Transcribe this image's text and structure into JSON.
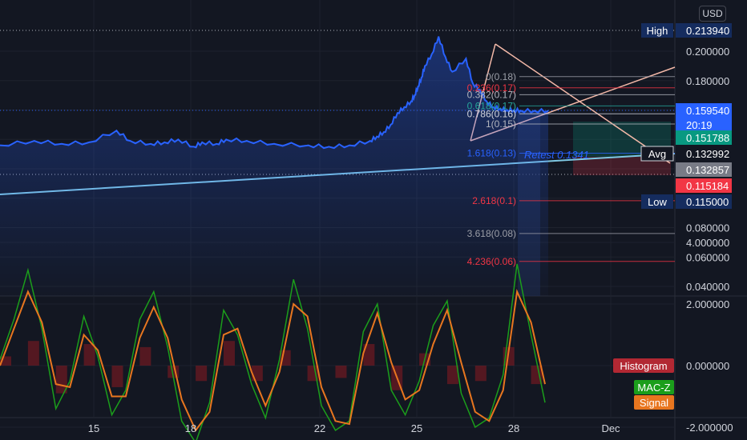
{
  "currency_badge": "USD",
  "chart_data": [
    {
      "type": "line",
      "title": "",
      "x_ticks": [
        "15",
        "18",
        "22",
        "25",
        "28",
        "Dec"
      ],
      "y_ticks": [
        "0.200000",
        "0.180000",
        "0.080000",
        "0.060000",
        "0.040000"
      ],
      "ylim": [
        0.033,
        0.222
      ],
      "series": [
        {
          "x": [
            0,
            5,
            9,
            13,
            17,
            19,
            22,
            24,
            26,
            28.3,
            29.5,
            31.6,
            33,
            36,
            40,
            45,
            48,
            51,
            54,
            55,
            56,
            57,
            58,
            59,
            60,
            60.5,
            61,
            61.5,
            62,
            63,
            64,
            65,
            66,
            68,
            69,
            70,
            71,
            72,
            73,
            74,
            75,
            76,
            78,
            80
          ],
          "values": [
            0.136,
            0.139,
            0.137,
            0.138,
            0.146,
            0.139,
            0.137,
            0.138,
            0.14,
            0.135,
            0.138,
            0.137,
            0.14,
            0.139,
            0.137,
            0.136,
            0.135,
            0.136,
            0.139,
            0.142,
            0.145,
            0.15,
            0.158,
            0.162,
            0.166,
            0.17,
            0.176,
            0.182,
            0.19,
            0.198,
            0.21,
            0.196,
            0.186,
            0.195,
            0.178,
            0.174,
            0.166,
            0.162,
            0.161,
            0.16,
            0.16,
            0.1596,
            0.1595,
            0.1595
          ],
          "color": "#2962ff"
        }
      ],
      "fib_levels": [
        {
          "label": "0(0.18)",
          "value": 0.1827,
          "color": "#9b9ea7"
        },
        {
          "label": "0.236(0.17)",
          "value": 0.1751,
          "color": "#f23645"
        },
        {
          "label": "0.382(0.17)",
          "value": 0.1704,
          "color": "#b2b5be"
        },
        {
          "label": "0.618(0.17)",
          "value": 0.1628,
          "color": "#26a69a"
        },
        {
          "label": "0.786(0.16)",
          "value": 0.1574,
          "color": "#d1d4dc"
        },
        {
          "label": "1(0.15)",
          "value": 0.1505,
          "color": "#b2b5be"
        },
        {
          "label": "1.618(0.13)",
          "value": 0.1306,
          "color": "#2962ff"
        },
        {
          "label": "2.618(0.1)",
          "value": 0.0983,
          "color": "#f23645"
        },
        {
          "label": "3.618(0.08)",
          "value": 0.076,
          "color": "#9b9ea7"
        },
        {
          "label": "4.236(0.06)",
          "value": 0.057,
          "color": "#f23645"
        }
      ],
      "annotations": {
        "retest_text": "Retest 0.1341"
      },
      "price_labels": [
        {
          "tag": "High",
          "value": "0.213940",
          "bg": "#152c5e"
        },
        {
          "tag": "",
          "value": "0.159540",
          "bg": "#2962ff",
          "sub": "20:19"
        },
        {
          "tag": "",
          "value": "0.151788",
          "bg": "#089981"
        },
        {
          "tag": "Avg",
          "value": "0.132992",
          "bg": "#131722"
        },
        {
          "tag": "",
          "value": "0.132857",
          "bg": "#787b86"
        },
        {
          "tag": "",
          "value": "0.115184",
          "bg": "#f23645"
        },
        {
          "tag": "Low",
          "value": "0.115000",
          "bg": "#152c5e"
        }
      ]
    },
    {
      "type": "line",
      "title": "",
      "y_ticks": [
        "4.000000",
        "2.000000",
        "0.000000",
        "-2.000000"
      ],
      "ylim": [
        -2.9,
        4.2
      ],
      "series": [
        {
          "name": "MAC-Z",
          "color": "#1b9e1b",
          "x": [
            0,
            2,
            4,
            6,
            8,
            10,
            12,
            14,
            16,
            18,
            20,
            22,
            24,
            26,
            28,
            30,
            32,
            34,
            36,
            38,
            40,
            42,
            44,
            46,
            48,
            50,
            52,
            54,
            56,
            58,
            60,
            62,
            64,
            66,
            68,
            70,
            72,
            74,
            76,
            78
          ],
          "values": [
            0.2,
            1.5,
            3.1,
            1.2,
            -1.4,
            -0.5,
            1.6,
            0.3,
            -1.6,
            -0.8,
            1.5,
            2.4,
            0.6,
            -1.8,
            -2.5,
            -1.2,
            1.8,
            1.0,
            -0.6,
            -1.7,
            0.2,
            2.8,
            1.2,
            -1.3,
            -2.1,
            -1.8,
            1.1,
            2.0,
            -0.8,
            -1.6,
            -0.5,
            1.3,
            2.1,
            -0.9,
            -2.0,
            -1.7,
            -0.3,
            3.3,
            1.0,
            -1.2
          ]
        },
        {
          "name": "Signal",
          "color": "#e8761f",
          "x": [
            0,
            2,
            4,
            6,
            8,
            10,
            12,
            14,
            16,
            18,
            20,
            22,
            24,
            26,
            28,
            30,
            32,
            34,
            36,
            38,
            40,
            42,
            44,
            46,
            48,
            50,
            52,
            54,
            56,
            58,
            60,
            62,
            64,
            66,
            68,
            70,
            72,
            74,
            76,
            78
          ],
          "values": [
            0.0,
            1.2,
            2.4,
            1.4,
            -0.6,
            -0.7,
            1.0,
            0.5,
            -1.0,
            -1.0,
            0.9,
            1.9,
            0.9,
            -1.1,
            -2.1,
            -1.5,
            1.0,
            1.2,
            -0.2,
            -1.3,
            -0.2,
            2.0,
            1.6,
            -0.7,
            -1.8,
            -1.9,
            0.4,
            1.7,
            0.1,
            -1.1,
            -0.8,
            0.7,
            1.8,
            0.1,
            -1.5,
            -1.8,
            -0.8,
            2.4,
            1.4,
            -0.6
          ]
        },
        {
          "name": "Histogram",
          "color": "#801922",
          "x": [
            0,
            4,
            8,
            12,
            16,
            20,
            24,
            28,
            32,
            36,
            40,
            44,
            48,
            52,
            56,
            60,
            64,
            68,
            72,
            76
          ],
          "values": [
            0.3,
            0.8,
            -0.9,
            0.7,
            -0.7,
            0.6,
            -0.4,
            -0.5,
            0.8,
            -0.5,
            0.5,
            -0.5,
            -0.4,
            0.7,
            -0.8,
            0.4,
            -0.6,
            -0.5,
            0.6,
            -0.6
          ]
        }
      ],
      "legend_tags": [
        {
          "text": "Histogram",
          "bg": "#b22833"
        },
        {
          "text": "MAC-Z",
          "bg": "#1b9e1b"
        },
        {
          "text": "Signal",
          "bg": "#e8761f"
        }
      ]
    }
  ]
}
